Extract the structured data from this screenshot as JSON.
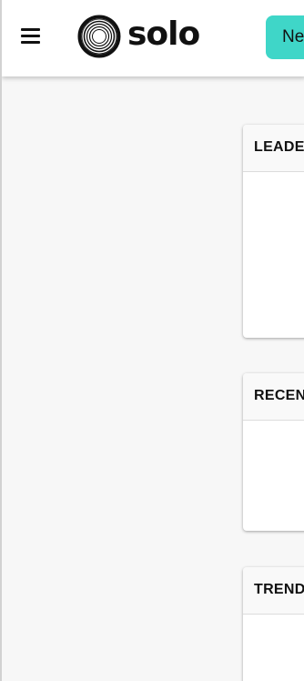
{
  "header": {
    "menu_icon": "hamburger-menu-icon",
    "logo_icon": "concentric-circle-logo-icon",
    "logo_text": "solo",
    "new_button_label": "New"
  },
  "cards": [
    {
      "title": "LEADERBOARD"
    },
    {
      "title": "RECENT"
    },
    {
      "title": "TRENDING"
    }
  ],
  "colors": {
    "accent": "#3fd6c8",
    "page_background": "#f7f7f7",
    "header_background": "#ffffff",
    "text": "#111111"
  }
}
